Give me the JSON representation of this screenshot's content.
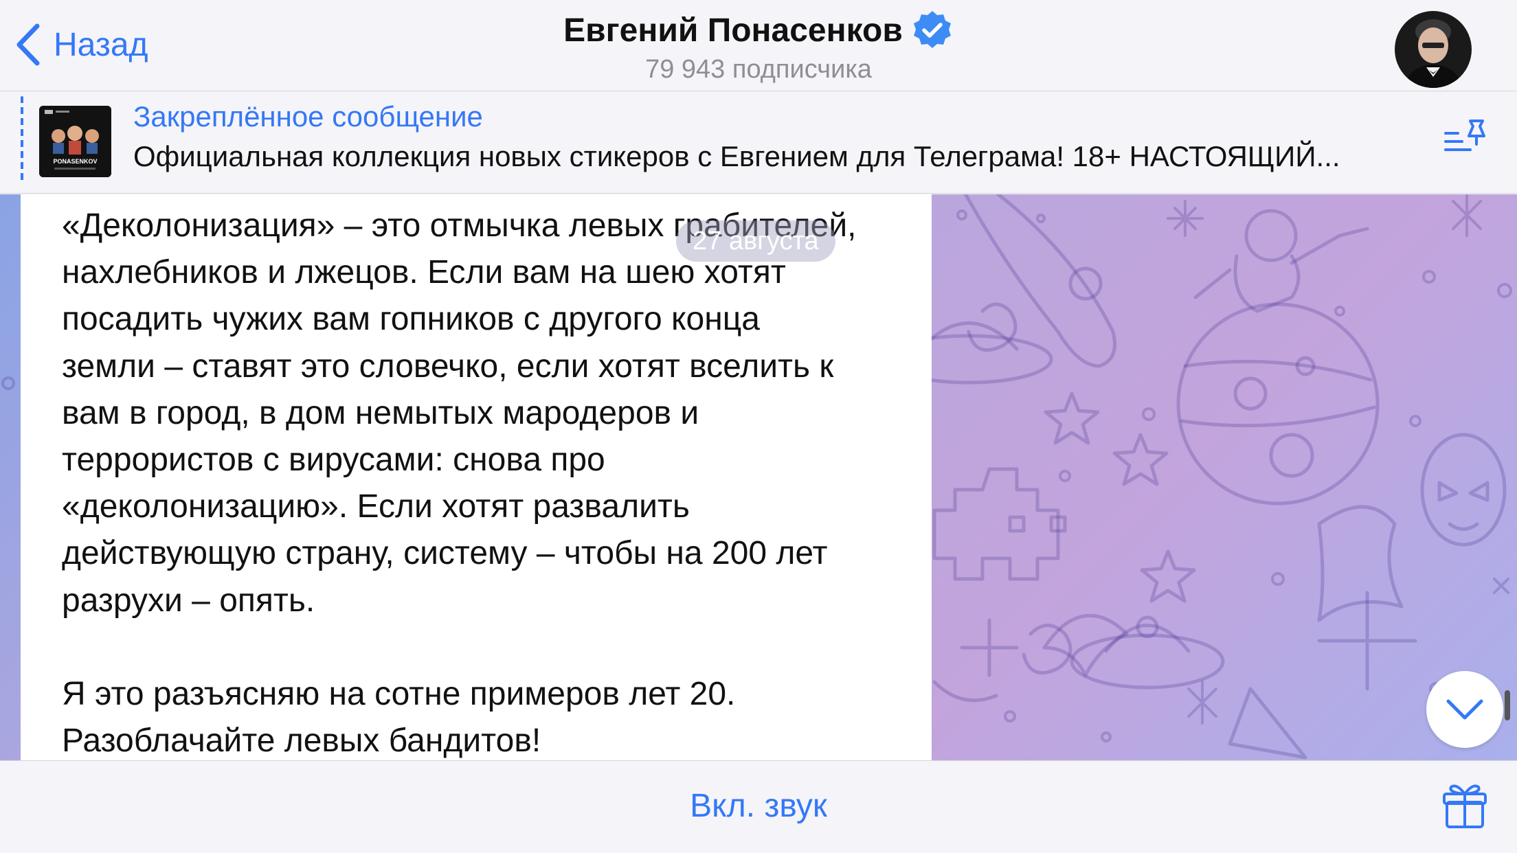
{
  "header": {
    "back_label": "Назад",
    "title": "Евгений Понасенков",
    "subtitle": "79 943 подписчика"
  },
  "pinned": {
    "title": "Закреплённое сообщение",
    "text": "Официальная коллекция новых стикеров с Евгением для Телеграма! 18+ НАСТОЯЩИЙ...",
    "thumb_caption": "PONASENKOV"
  },
  "chat": {
    "date_label": "27 августа",
    "message_lines": [
      "«Деколонизация» – это отмычка левых грабителей,",
      "нахлебников и лжецов. Если вам на шею хотят",
      "посадить чужих вам гопников с другого конца",
      "земли – ставят это словечко, если хотят вселить к",
      "вам в город, в дом немытых мародеров и",
      "террористов с вирусами: снова про",
      "«деколонизацию». Если хотят развалить",
      "действующую страну, систему – чтобы на 200 лет",
      "разрухи – опять.",
      "",
      "Я это разъясняю на сотне примеров лет 20.",
      "Разоблачайте левых бандитов!"
    ]
  },
  "bottom": {
    "unmute_label": "Вкл. звук"
  },
  "icons": {
    "back": "chevron-left-icon",
    "verified": "verified-badge-icon",
    "pin_list": "pinned-list-icon",
    "scroll_down": "chevron-down-icon",
    "gift": "gift-icon"
  },
  "colors": {
    "accent": "#3478f6",
    "background_bar": "#f5f4f8",
    "bubble": "#ffffff"
  }
}
